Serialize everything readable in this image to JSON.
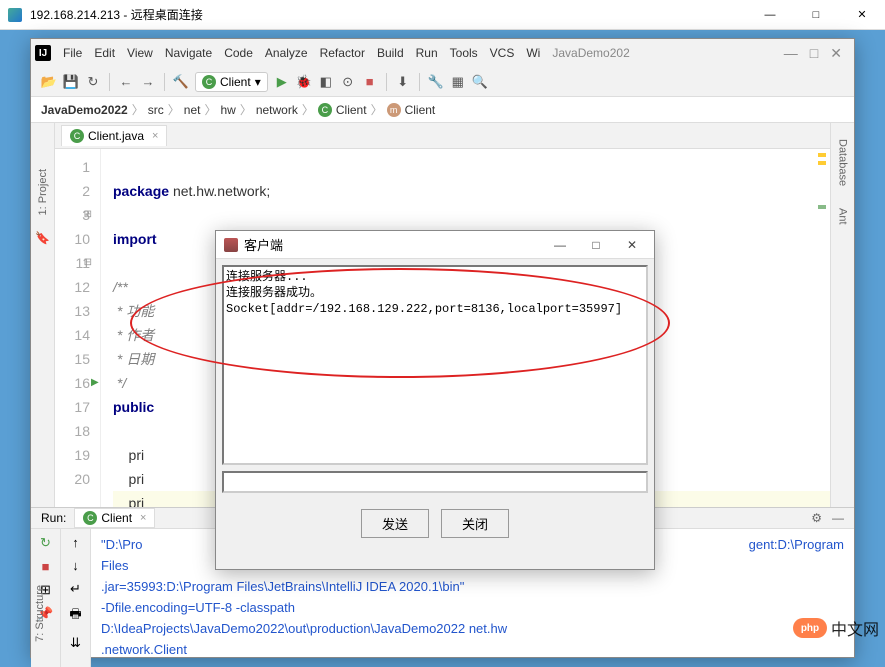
{
  "rdp": {
    "title": "192.168.214.213 - 远程桌面连接",
    "min": "—",
    "max": "□",
    "close": "✕"
  },
  "ide": {
    "title": "JavaDemo202",
    "min": "—",
    "max": "□",
    "close": "✕",
    "menu": [
      "File",
      "Edit",
      "View",
      "Navigate",
      "Code",
      "Analyze",
      "Refactor",
      "Build",
      "Run",
      "Tools",
      "VCS",
      "Wi"
    ],
    "run_config": "Client",
    "breadcrumb": [
      "JavaDemo2022",
      "src",
      "net",
      "hw",
      "network",
      "Client",
      "Client"
    ],
    "left_tabs": [
      "1: Project"
    ],
    "right_tabs": [
      "Database",
      "Ant"
    ],
    "editor_tab": "Client.java",
    "lines": [
      "1",
      "2",
      "3",
      "10",
      "11",
      "12",
      "13",
      "14",
      "15",
      "16",
      "17",
      "18",
      "19",
      "20"
    ],
    "code": {
      "l1_kw": "package ",
      "l1_rest": "net.hw.network;",
      "l3_kw": "import",
      "l11_a": "/**",
      "l12_a": " * 功能",
      "l13_a": " * 作者",
      "l14_a": " * 日期",
      "l15_a": " */",
      "l16_kw": "public",
      "l18": "    pri",
      "l19": "    pri",
      "l20": "    pri"
    },
    "run": {
      "label": "Run:",
      "tab": "Client",
      "console": [
        "\"D:\\Pro",
        "Files",
        ".jar=35993:D:\\Program Files\\JetBrains\\IntelliJ IDEA 2020.1\\bin\"",
        "-Dfile.encoding=UTF-8 -classpath",
        "D:\\IdeaProjects\\JavaDemo2022\\out\\production\\JavaDemo2022 net.hw",
        ".network.Client"
      ],
      "console_right": "gent:D:\\Program"
    },
    "structure_tab": "7: Structure"
  },
  "dialog": {
    "title": "客户端",
    "min": "—",
    "max": "□",
    "close": "✕",
    "text": "连接服务器...\n连接服务器成功。\nSocket[addr=/192.168.129.222,port=8136,localport=35997]",
    "send": "发送",
    "close_btn": "关闭"
  },
  "badge": {
    "icon": "php",
    "text": "中文网"
  }
}
